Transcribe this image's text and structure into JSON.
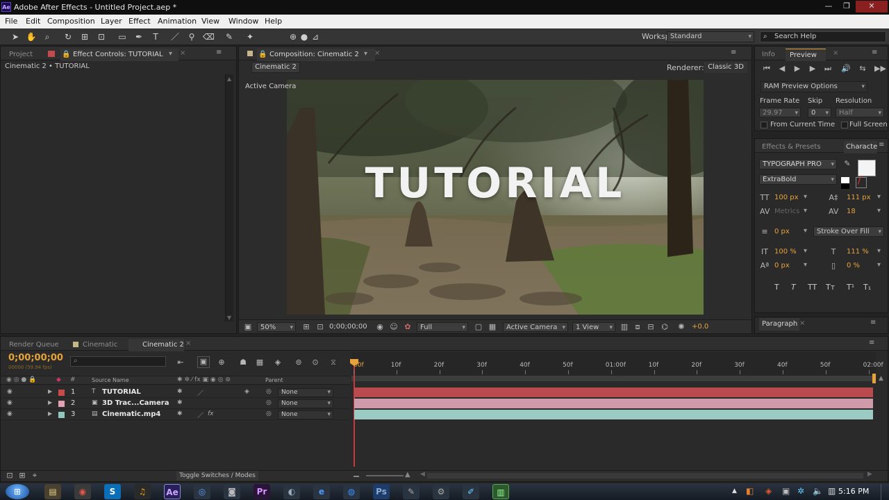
{
  "window": {
    "title": "Adobe After Effects - Untitled Project.aep *",
    "app_logo": "Ae"
  },
  "menu": [
    "File",
    "Edit",
    "Composition",
    "Layer",
    "Effect",
    "Animation",
    "View",
    "Window",
    "Help"
  ],
  "workspace": {
    "label": "Workspace:",
    "value": "Standard"
  },
  "search_help": "Search Help",
  "left_panel": {
    "tabs": [
      "Project",
      "Effect Controls: TUTORIAL"
    ],
    "breadcrumb": "Cinematic 2 • TUTORIAL"
  },
  "composition": {
    "tab": "Composition: Cinematic 2",
    "subtab": "Cinematic 2",
    "renderer_label": "Renderer:",
    "renderer_value": "Classic 3D",
    "camera_label": "Active Camera",
    "overlay_text": "TUTORIAL",
    "footer": {
      "zoom": "50%",
      "timecode": "0;00;00;00",
      "resolution": "Full",
      "camera": "Active Camera",
      "views": "1 View",
      "exposure": "+0.0"
    }
  },
  "preview": {
    "tabs": [
      "Info",
      "Preview"
    ],
    "ram_options": "RAM Preview Options",
    "frame_rate_label": "Frame Rate",
    "skip_label": "Skip",
    "resolution_label": "Resolution",
    "frame_rate": "29.97",
    "skip": "0",
    "resolution": "Half",
    "from_current_time": "From Current Time",
    "full_screen": "Full Screen"
  },
  "character": {
    "tabs": [
      "Effects & Presets",
      "Characte"
    ],
    "font": "TYPOGRAPH PRO",
    "style": "ExtraBold",
    "size": "100 px",
    "leading": "111 px",
    "kerning": "Metrics",
    "tracking": "18",
    "stroke_width": "0 px",
    "stroke_mode": "Stroke Over Fill",
    "vscale": "100 %",
    "hscale": "111 %",
    "baseline": "0 px",
    "tsume": "0 %",
    "style_buttons": [
      "T",
      "T",
      "TT",
      "Tт",
      "T¹",
      "T₁"
    ]
  },
  "paragraph": {
    "tab": "Paragraph"
  },
  "timeline": {
    "tabs": [
      "Render Queue",
      "Cinematic",
      "Cinematic 2"
    ],
    "timecode": "0;00;00;00",
    "fps": "00000 (59.94 fps)",
    "col_source": "Source Name",
    "col_parent": "Parent",
    "ruler": [
      "00f",
      "10f",
      "20f",
      "30f",
      "40f",
      "50f",
      "01:00f",
      "10f",
      "20f",
      "30f",
      "40f",
      "50f",
      "02:00f"
    ],
    "layers": [
      {
        "num": "1",
        "name": "TUTORIAL",
        "parent": "None",
        "color": "#c94a4a",
        "bar": "#b94a4e"
      },
      {
        "num": "2",
        "name": "3D Trac...Camera",
        "parent": "None",
        "color": "#e2a2b4",
        "bar": "#cf9aaa"
      },
      {
        "num": "3",
        "name": "Cinematic.mp4",
        "parent": "None",
        "color": "#8fc7be",
        "bar": "#9ccbc4"
      }
    ],
    "toggle": "Toggle Switches / Modes"
  },
  "taskbar": {
    "time": "5:16 PM"
  }
}
